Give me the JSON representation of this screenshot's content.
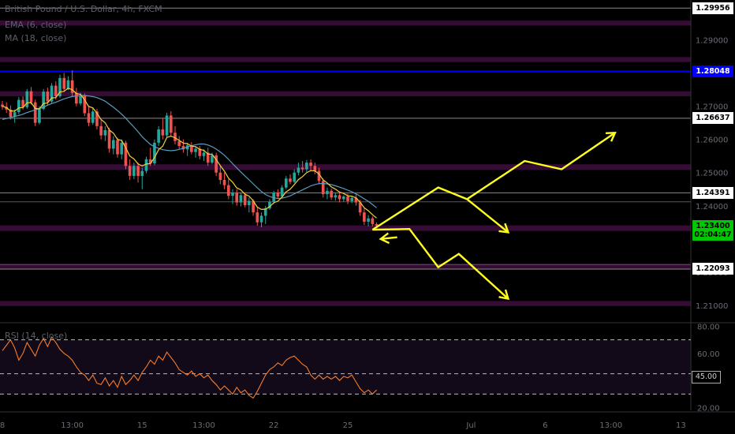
{
  "legend": {
    "title": "British Pound / U.S. Dollar, 4h, FXCM",
    "ema": "EMA (6, close)",
    "ma": "MA (18, close)",
    "rsi": "RSI (14, close)"
  },
  "colors": {
    "background": "#000000",
    "candle_up": "#26a69a",
    "candle_down": "#ef5350",
    "ema": "#f2d23b",
    "ma": "#5b9bbf",
    "rsi": "#f57c2b",
    "arrows": "#ffff1f",
    "resistance_line": "#0000ff",
    "zone": "#3a0d3a"
  },
  "price_tags": [
    {
      "label": "1.29956",
      "value": 1.29956,
      "bg": "#ffffff",
      "fg": "#000000"
    },
    {
      "label": "1.28048",
      "value": 1.28048,
      "bg": "#0000ff",
      "fg": "#ffffff"
    },
    {
      "label": "1.26637",
      "value": 1.26637,
      "bg": "#ffffff",
      "fg": "#000000"
    },
    {
      "label": "1.24391",
      "value": 1.24391,
      "bg": "#ffffff",
      "fg": "#000000"
    },
    {
      "label": "1.23400",
      "value": 1.234,
      "bg": "#00c800",
      "fg": "#000000"
    },
    {
      "label": "02:04:47",
      "value": 1.2312,
      "bg": "#00c800",
      "fg": "#000000"
    },
    {
      "label": "1.22093",
      "value": 1.22093,
      "bg": "#ffffff",
      "fg": "#000000"
    }
  ],
  "rsi_tag": "45.00",
  "chart_data": {
    "type": "candlestick",
    "title": "British Pound / U.S. Dollar, 4h, FXCM",
    "price_ticks": [
      "1.29000",
      "1.28000",
      "1.27000",
      "1.26000",
      "1.25000",
      "1.24000",
      "1.22000",
      "1.21000"
    ],
    "price_tick_values": [
      1.29,
      1.28,
      1.27,
      1.26,
      1.25,
      1.24,
      1.22,
      1.21
    ],
    "ylim": [
      1.205,
      1.302
    ],
    "x_labels": [
      "8",
      "13:00",
      "15",
      "13:00",
      "22",
      "25",
      "Jul",
      "6",
      "13:00",
      "13"
    ],
    "x_label_bars": [
      0,
      17,
      34,
      49,
      66,
      84,
      114,
      132,
      148,
      165
    ],
    "bars_visible": 168,
    "candles_ohlc": [
      [
        1.2705,
        1.2716,
        1.269,
        1.2698
      ],
      [
        1.2698,
        1.2712,
        1.268,
        1.269
      ],
      [
        1.269,
        1.2702,
        1.266,
        1.2668
      ],
      [
        1.2668,
        1.269,
        1.265,
        1.2682
      ],
      [
        1.2682,
        1.2728,
        1.2675,
        1.2719
      ],
      [
        1.2719,
        1.273,
        1.269,
        1.2697
      ],
      [
        1.2697,
        1.2752,
        1.2692,
        1.2745
      ],
      [
        1.2745,
        1.2758,
        1.2705,
        1.2712
      ],
      [
        1.2712,
        1.272,
        1.264,
        1.265
      ],
      [
        1.265,
        1.27,
        1.2645,
        1.2692
      ],
      [
        1.2692,
        1.2752,
        1.2688,
        1.2744
      ],
      [
        1.2744,
        1.2756,
        1.2702,
        1.2714
      ],
      [
        1.2714,
        1.277,
        1.2708,
        1.2762
      ],
      [
        1.2762,
        1.2775,
        1.272,
        1.273
      ],
      [
        1.273,
        1.2795,
        1.2725,
        1.2785
      ],
      [
        1.2785,
        1.28,
        1.2745,
        1.2752
      ],
      [
        1.2752,
        1.279,
        1.2748,
        1.2778
      ],
      [
        1.2778,
        1.2808,
        1.273,
        1.274
      ],
      [
        1.274,
        1.2755,
        1.27,
        1.2708
      ],
      [
        1.2708,
        1.274,
        1.2702,
        1.2731
      ],
      [
        1.2731,
        1.2738,
        1.267,
        1.2679
      ],
      [
        1.2679,
        1.27,
        1.264,
        1.265
      ],
      [
        1.265,
        1.2695,
        1.2644,
        1.2684
      ],
      [
        1.2684,
        1.2692,
        1.263,
        1.264
      ],
      [
        1.264,
        1.266,
        1.26,
        1.2612
      ],
      [
        1.2612,
        1.264,
        1.2595,
        1.2628
      ],
      [
        1.2628,
        1.2635,
        1.256,
        1.2572
      ],
      [
        1.2572,
        1.261,
        1.2555,
        1.2598
      ],
      [
        1.2598,
        1.2605,
        1.2545,
        1.2555
      ],
      [
        1.2555,
        1.26,
        1.254,
        1.259
      ],
      [
        1.259,
        1.2596,
        1.251,
        1.252
      ],
      [
        1.252,
        1.254,
        1.2478,
        1.249
      ],
      [
        1.249,
        1.253,
        1.248,
        1.252
      ],
      [
        1.252,
        1.253,
        1.247,
        1.249
      ],
      [
        1.249,
        1.2515,
        1.245,
        1.2505
      ],
      [
        1.2505,
        1.2548,
        1.2498,
        1.254
      ],
      [
        1.254,
        1.2575,
        1.252,
        1.2528
      ],
      [
        1.2528,
        1.26,
        1.2522,
        1.259
      ],
      [
        1.259,
        1.264,
        1.258,
        1.263
      ],
      [
        1.263,
        1.2665,
        1.26,
        1.2612
      ],
      [
        1.2612,
        1.268,
        1.2605,
        1.2672
      ],
      [
        1.2672,
        1.2685,
        1.261,
        1.262
      ],
      [
        1.262,
        1.264,
        1.2585,
        1.2595
      ],
      [
        1.2595,
        1.261,
        1.257,
        1.258
      ],
      [
        1.258,
        1.26,
        1.256,
        1.257
      ],
      [
        1.257,
        1.259,
        1.255,
        1.2582
      ],
      [
        1.2582,
        1.2592,
        1.2555,
        1.2562
      ],
      [
        1.2562,
        1.258,
        1.2545,
        1.2572
      ],
      [
        1.2572,
        1.258,
        1.254,
        1.255
      ],
      [
        1.255,
        1.257,
        1.2535,
        1.256
      ],
      [
        1.256,
        1.2575,
        1.252,
        1.253
      ],
      [
        1.253,
        1.256,
        1.2525,
        1.2552
      ],
      [
        1.2552,
        1.256,
        1.249,
        1.25
      ],
      [
        1.25,
        1.252,
        1.2465,
        1.2478
      ],
      [
        1.2478,
        1.25,
        1.245,
        1.2462
      ],
      [
        1.2462,
        1.248,
        1.242,
        1.243
      ],
      [
        1.243,
        1.245,
        1.2405,
        1.244
      ],
      [
        1.244,
        1.245,
        1.24,
        1.241
      ],
      [
        1.241,
        1.244,
        1.2398,
        1.2432
      ],
      [
        1.2432,
        1.244,
        1.2395,
        1.2402
      ],
      [
        1.2402,
        1.2425,
        1.238,
        1.2415
      ],
      [
        1.2415,
        1.242,
        1.237,
        1.238
      ],
      [
        1.238,
        1.2395,
        1.234,
        1.235
      ],
      [
        1.235,
        1.238,
        1.2335,
        1.237
      ],
      [
        1.237,
        1.24,
        1.2345,
        1.2392
      ],
      [
        1.2392,
        1.242,
        1.2388,
        1.2412
      ],
      [
        1.2412,
        1.2445,
        1.2405,
        1.244
      ],
      [
        1.244,
        1.245,
        1.242,
        1.2428
      ],
      [
        1.2428,
        1.2462,
        1.2422,
        1.2455
      ],
      [
        1.2455,
        1.249,
        1.245,
        1.2482
      ],
      [
        1.2482,
        1.2495,
        1.2465,
        1.2472
      ],
      [
        1.2472,
        1.251,
        1.2468,
        1.25
      ],
      [
        1.25,
        1.253,
        1.2492,
        1.2515
      ],
      [
        1.2515,
        1.2535,
        1.25,
        1.251
      ],
      [
        1.251,
        1.2538,
        1.2502,
        1.253
      ],
      [
        1.253,
        1.254,
        1.2505,
        1.252
      ],
      [
        1.252,
        1.253,
        1.2495,
        1.2505
      ],
      [
        1.2505,
        1.2515,
        1.2465,
        1.2475
      ],
      [
        1.2475,
        1.2482,
        1.2425,
        1.2435
      ],
      [
        1.2435,
        1.2455,
        1.242,
        1.2445
      ],
      [
        1.2445,
        1.2452,
        1.2418,
        1.2425
      ],
      [
        1.2425,
        1.244,
        1.2415,
        1.2432
      ],
      [
        1.2432,
        1.244,
        1.241,
        1.242
      ],
      [
        1.242,
        1.2432,
        1.2412,
        1.2428
      ],
      [
        1.2428,
        1.2436,
        1.2405,
        1.2414
      ],
      [
        1.2414,
        1.243,
        1.2408,
        1.2424
      ],
      [
        1.2424,
        1.2434,
        1.24,
        1.241
      ],
      [
        1.241,
        1.2418,
        1.237,
        1.238
      ],
      [
        1.238,
        1.2392,
        1.2342,
        1.2352
      ],
      [
        1.2352,
        1.2372,
        1.2338,
        1.2362
      ],
      [
        1.2362,
        1.2368,
        1.2338,
        1.2345
      ],
      [
        1.2345,
        1.235,
        1.2335,
        1.234
      ]
    ],
    "ema_6": [
      1.27,
      1.2696,
      1.2686,
      1.2685,
      1.2695,
      1.2696,
      1.271,
      1.2711,
      1.2693,
      1.2692,
      1.2708,
      1.271,
      1.2725,
      1.2726,
      1.2743,
      1.2745,
      1.2754,
      1.275,
      1.2738,
      1.2736,
      1.2719,
      1.2699,
      1.2695,
      1.2679,
      1.266,
      1.265,
      1.2628,
      1.2619,
      1.26,
      1.2597,
      1.2575,
      1.255,
      1.2541,
      1.2526,
      1.252,
      1.2526,
      1.2527,
      1.2545,
      1.2569,
      1.258,
      1.2606,
      1.261,
      1.2605,
      1.2597,
      1.2589,
      1.2587,
      1.258,
      1.2578,
      1.257,
      1.2567,
      1.2556,
      1.2555,
      1.2539,
      1.2521,
      1.2504,
      1.2483,
      1.2471,
      1.2454,
      1.2448,
      1.2435,
      1.2429,
      1.2415,
      1.2396,
      1.2389,
      1.239,
      1.2397,
      1.2409,
      1.2414,
      1.2426,
      1.2442,
      1.245,
      1.2464,
      1.2479,
      1.2488,
      1.25,
      1.2506,
      1.2505,
      1.2496,
      1.2478,
      1.2469,
      1.2457,
      1.245,
      1.2441,
      1.2437,
      1.243,
      1.2429,
      1.2424,
      1.2411,
      1.2394,
      1.2385,
      1.2373,
      1.2363
    ],
    "ma_18": [
      1.266,
      1.2663,
      1.2666,
      1.2669,
      1.2672,
      1.2676,
      1.2681,
      1.2685,
      1.2689,
      1.2693,
      1.2697,
      1.2703,
      1.2708,
      1.2712,
      1.2717,
      1.2722,
      1.2726,
      1.2729,
      1.2731,
      1.2732,
      1.2732,
      1.2731,
      1.2729,
      1.2726,
      1.2721,
      1.2715,
      1.2706,
      1.2697,
      1.2687,
      1.2676,
      1.2664,
      1.265,
      1.2637,
      1.2623,
      1.2608,
      1.2596,
      1.2585,
      1.2578,
      1.2573,
      1.2569,
      1.2567,
      1.2566,
      1.2567,
      1.257,
      1.2573,
      1.2577,
      1.2581,
      1.2584,
      1.2586,
      1.2586,
      1.2583,
      1.2578,
      1.2571,
      1.2562,
      1.2552,
      1.254,
      1.2527,
      1.2514,
      1.2502,
      1.249,
      1.2478,
      1.2466,
      1.2454,
      1.2443,
      1.2434,
      1.2428,
      1.2424,
      1.2422,
      1.2423,
      1.2426,
      1.243,
      1.2436,
      1.2442,
      1.2448,
      1.2454,
      1.246,
      1.2464,
      1.2467,
      1.2467,
      1.2466,
      1.2464,
      1.246,
      1.2456,
      1.2452,
      1.2447,
      1.2442,
      1.2436,
      1.2429,
      1.2421,
      1.2413,
      1.2404,
      1.2394
    ],
    "rsi_ticks": [
      "80.00",
      "60.00",
      "40.00",
      "20.00"
    ],
    "rsi_tick_values": [
      80,
      60,
      40,
      20
    ],
    "rsi_ylim": [
      18,
      82
    ],
    "rsi_bands": [
      70,
      45,
      30
    ],
    "rsi_14": [
      62,
      66,
      70,
      64,
      55,
      60,
      68,
      63,
      58,
      66,
      71,
      65,
      72,
      68,
      63,
      60,
      58,
      55,
      50,
      46,
      44,
      40,
      44,
      38,
      37,
      42,
      36,
      40,
      35,
      43,
      37,
      40,
      44,
      40,
      46,
      50,
      55,
      52,
      58,
      55,
      61,
      57,
      53,
      48,
      46,
      44,
      47,
      43,
      45,
      42,
      44,
      40,
      37,
      33,
      36,
      33,
      30,
      35,
      31,
      33,
      29,
      27,
      32,
      38,
      44,
      48,
      50,
      53,
      51,
      55,
      57,
      58,
      55,
      52,
      50,
      44,
      41,
      44,
      41,
      43,
      41,
      43,
      40,
      43,
      42,
      44,
      39,
      34,
      31,
      33,
      30,
      33
    ],
    "support_resistance": [
      1.29956,
      1.28048,
      1.26637,
      1.24391,
      1.22093
    ],
    "zones": [
      [
        1.2943,
        1.2958
      ],
      [
        1.2833,
        1.2848
      ],
      [
        1.273,
        1.2745
      ],
      [
        1.2508,
        1.2525
      ],
      [
        1.2324,
        1.2341
      ],
      [
        1.221,
        1.2225
      ],
      [
        1.2098,
        1.2113
      ]
    ],
    "projection_paths": [
      [
        [
          90,
          1.2328
        ],
        [
          106,
          1.2455
        ],
        [
          113,
          1.242
        ],
        [
          127,
          1.2535
        ],
        [
          136,
          1.251
        ],
        [
          149,
          1.262
        ]
      ],
      [
        [
          90,
          1.2328
        ],
        [
          99,
          1.233
        ],
        [
          106,
          1.2215
        ],
        [
          111,
          1.2255
        ],
        [
          123,
          1.212
        ]
      ],
      [
        [
          113,
          1.242
        ],
        [
          123,
          1.232
        ]
      ],
      [
        [
          96,
          1.2305
        ],
        [
          92,
          1.23
        ]
      ]
    ]
  }
}
